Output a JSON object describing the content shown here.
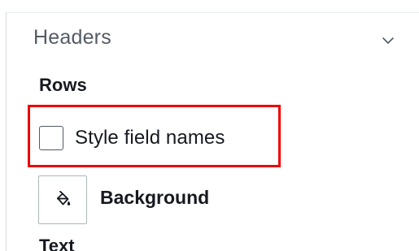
{
  "section": {
    "title": "Headers",
    "expand_icon": "chevron-down-icon"
  },
  "rows": {
    "label": "Rows",
    "style_field_names": {
      "label": "Style field names",
      "checked": false
    },
    "background": {
      "label": "Background",
      "icon": "paint-bucket-icon"
    }
  },
  "text": {
    "label": "Text"
  },
  "colors": {
    "highlight": "#ef0000",
    "heading": "#545b64",
    "text": "#16191f",
    "border": "#aab7b8"
  }
}
